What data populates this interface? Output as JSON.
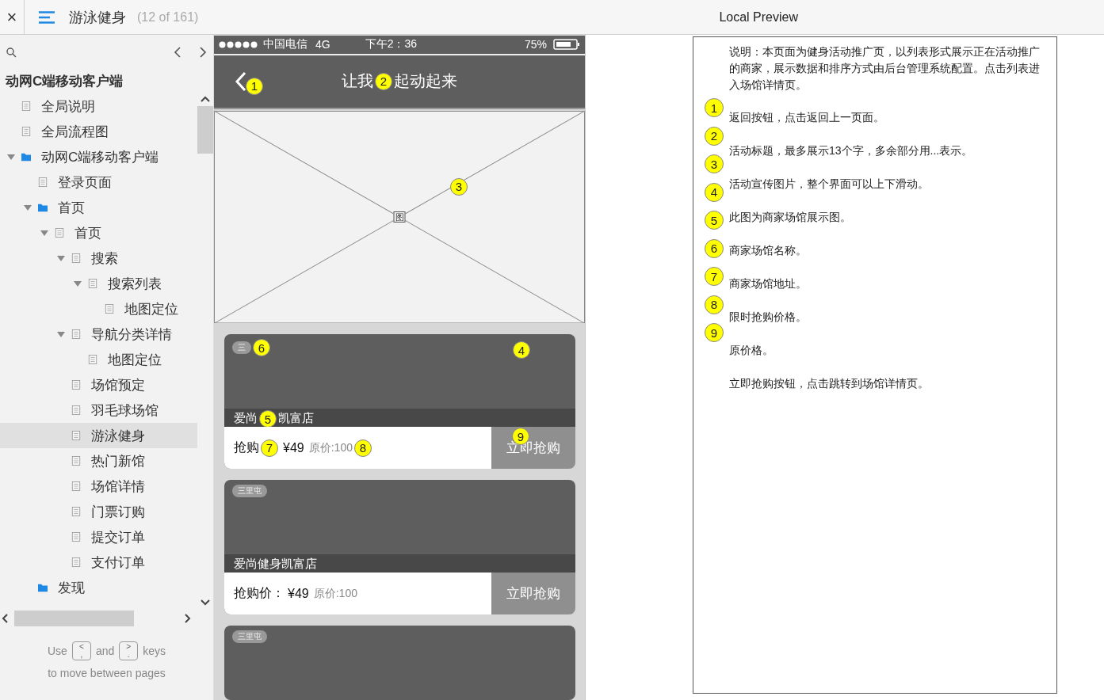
{
  "topbar": {
    "close": "×",
    "page_title": "游泳健身",
    "page_count": "(12 of 161)",
    "preview_title": "Local Preview"
  },
  "sidebar": {
    "project_title": "动网C端移动客户端",
    "tree": [
      {
        "label": "全局说明",
        "kind": "page"
      },
      {
        "label": "全局流程图",
        "kind": "page"
      },
      {
        "label": "动网C端移动客户端",
        "kind": "folder",
        "expanded": true,
        "children": [
          {
            "label": "登录页面",
            "kind": "page"
          },
          {
            "label": "首页",
            "kind": "folder",
            "expanded": true,
            "children": [
              {
                "label": "首页",
                "kind": "page",
                "expanded": true,
                "children": [
                  {
                    "label": "搜索",
                    "kind": "page",
                    "expanded": true,
                    "children": [
                      {
                        "label": "搜索列表",
                        "kind": "page",
                        "expanded": true,
                        "children": [
                          {
                            "label": "地图定位",
                            "kind": "page"
                          }
                        ]
                      }
                    ]
                  },
                  {
                    "label": "导航分类详情",
                    "kind": "page",
                    "expanded": true,
                    "children": [
                      {
                        "label": "地图定位",
                        "kind": "page"
                      }
                    ]
                  },
                  {
                    "label": "场馆预定",
                    "kind": "page"
                  },
                  {
                    "label": "羽毛球场馆",
                    "kind": "page"
                  },
                  {
                    "label": "游泳健身",
                    "kind": "page",
                    "selected": true
                  },
                  {
                    "label": "热门新馆",
                    "kind": "page"
                  },
                  {
                    "label": "场馆详情",
                    "kind": "page"
                  },
                  {
                    "label": "门票订购",
                    "kind": "page"
                  },
                  {
                    "label": "提交订单",
                    "kind": "page"
                  },
                  {
                    "label": "支付订单",
                    "kind": "page"
                  }
                ]
              }
            ]
          },
          {
            "label": "发现",
            "kind": "folder"
          }
        ]
      }
    ],
    "footer": {
      "use": "Use",
      "key_prev": [
        "<",
        ","
      ],
      "and": "and",
      "key_next": [
        ">",
        "."
      ],
      "keys": "keys",
      "line2": "to move between pages"
    }
  },
  "phone": {
    "status": {
      "carrier": "中国电信",
      "network": "4G",
      "time": "下午2：36",
      "battery": "75%"
    },
    "nav": {
      "back_marker": "1",
      "title": [
        "让我",
        "起动起来"
      ],
      "title_marker": "2"
    },
    "banner": {
      "label": "图",
      "marker": "3"
    },
    "cards": [
      {
        "tag": "三",
        "name": [
          "爱尚",
          "凯富店"
        ],
        "price_label": "抢购",
        "price": "¥49",
        "original": "原价:100",
        "button": "立即抢购",
        "markers": {
          "tag": "6",
          "image": "4",
          "name": "5",
          "price": "7",
          "original": "8",
          "button": "9"
        }
      },
      {
        "tag": "三里屯",
        "name": [
          "爱尚健身凯富店"
        ],
        "price_label": "抢购价：",
        "price": "¥49",
        "original": "原价:100",
        "button": "立即抢购"
      },
      {
        "tag": "三里屯"
      }
    ]
  },
  "notes": {
    "description": "说明：本页面为健身活动推广页，以列表形式展示正在活动推广的商家，展示数据和排序方式由后台管理系统配置。点击列表进入场馆详情页。",
    "markers": [
      "1",
      "2",
      "3",
      "4",
      "5",
      "6",
      "7",
      "8",
      "9"
    ],
    "lines": [
      "返回按钮，点击返回上一页面。",
      "活动标题，最多展示13个字，多余部分用...表示。",
      "活动宣传图片，整个界面可以上下滑动。",
      "此图为商家场馆展示图。",
      "商家场馆名称。",
      "商家场馆地址。",
      "限时抢购价格。",
      "原价格。",
      "立即抢购按钮，点击跳转到场馆详情页。"
    ]
  }
}
